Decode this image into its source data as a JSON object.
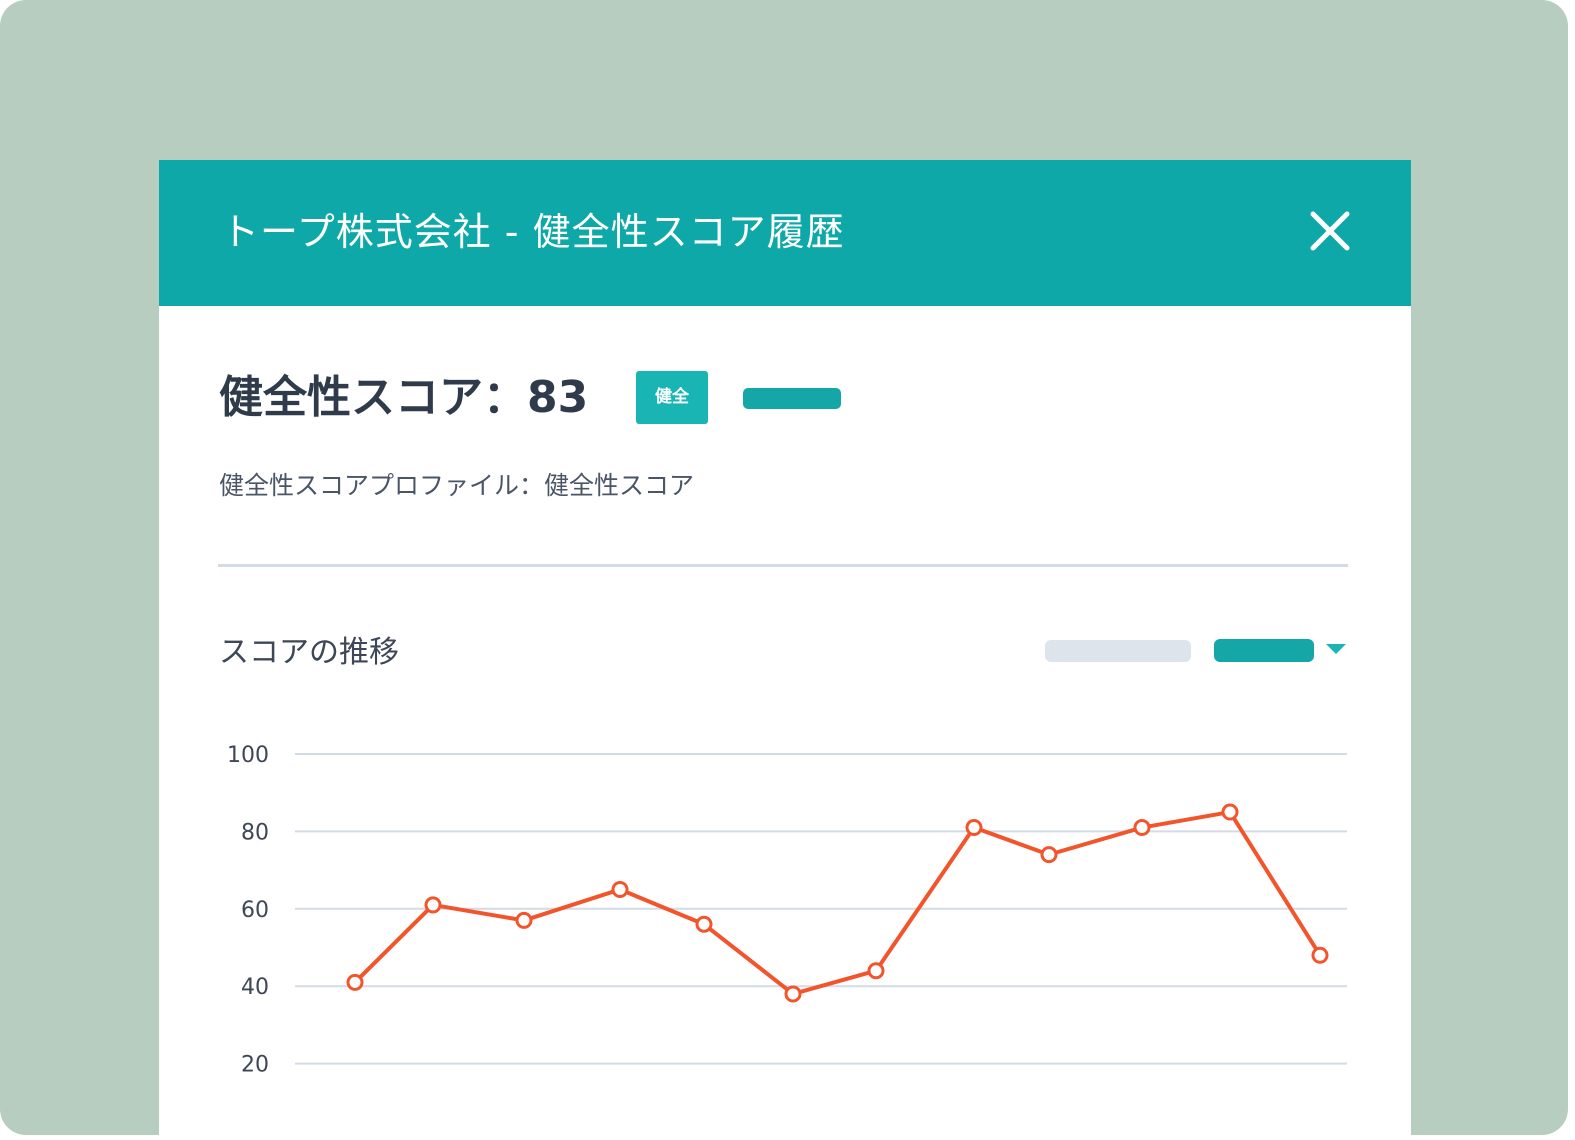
{
  "dialog": {
    "title": "トープ株式会社 - 健全性スコア履歴",
    "close_icon": "close-icon"
  },
  "summary": {
    "score_heading": "健全性スコア：83",
    "status_badge": "健全",
    "profile_line": "健全性スコアプロファイル：健全性スコア"
  },
  "trend": {
    "section_title": "スコアの推移",
    "dropdown_icon": "chevron-down-icon"
  },
  "colors": {
    "header": "#0fa8a8",
    "line": "#f2552c",
    "grid": "#d3dbe6",
    "backdrop": "#b7cdbf"
  },
  "chart_data": {
    "type": "line",
    "title": "",
    "xlabel": "",
    "ylabel": "",
    "ylim": [
      0,
      100
    ],
    "yticks": [
      100,
      80,
      60,
      40,
      20
    ],
    "grid": true,
    "series": [
      {
        "values": [
          41,
          61,
          57,
          65,
          56,
          38,
          44,
          81,
          74,
          81,
          85,
          48
        ]
      }
    ]
  }
}
